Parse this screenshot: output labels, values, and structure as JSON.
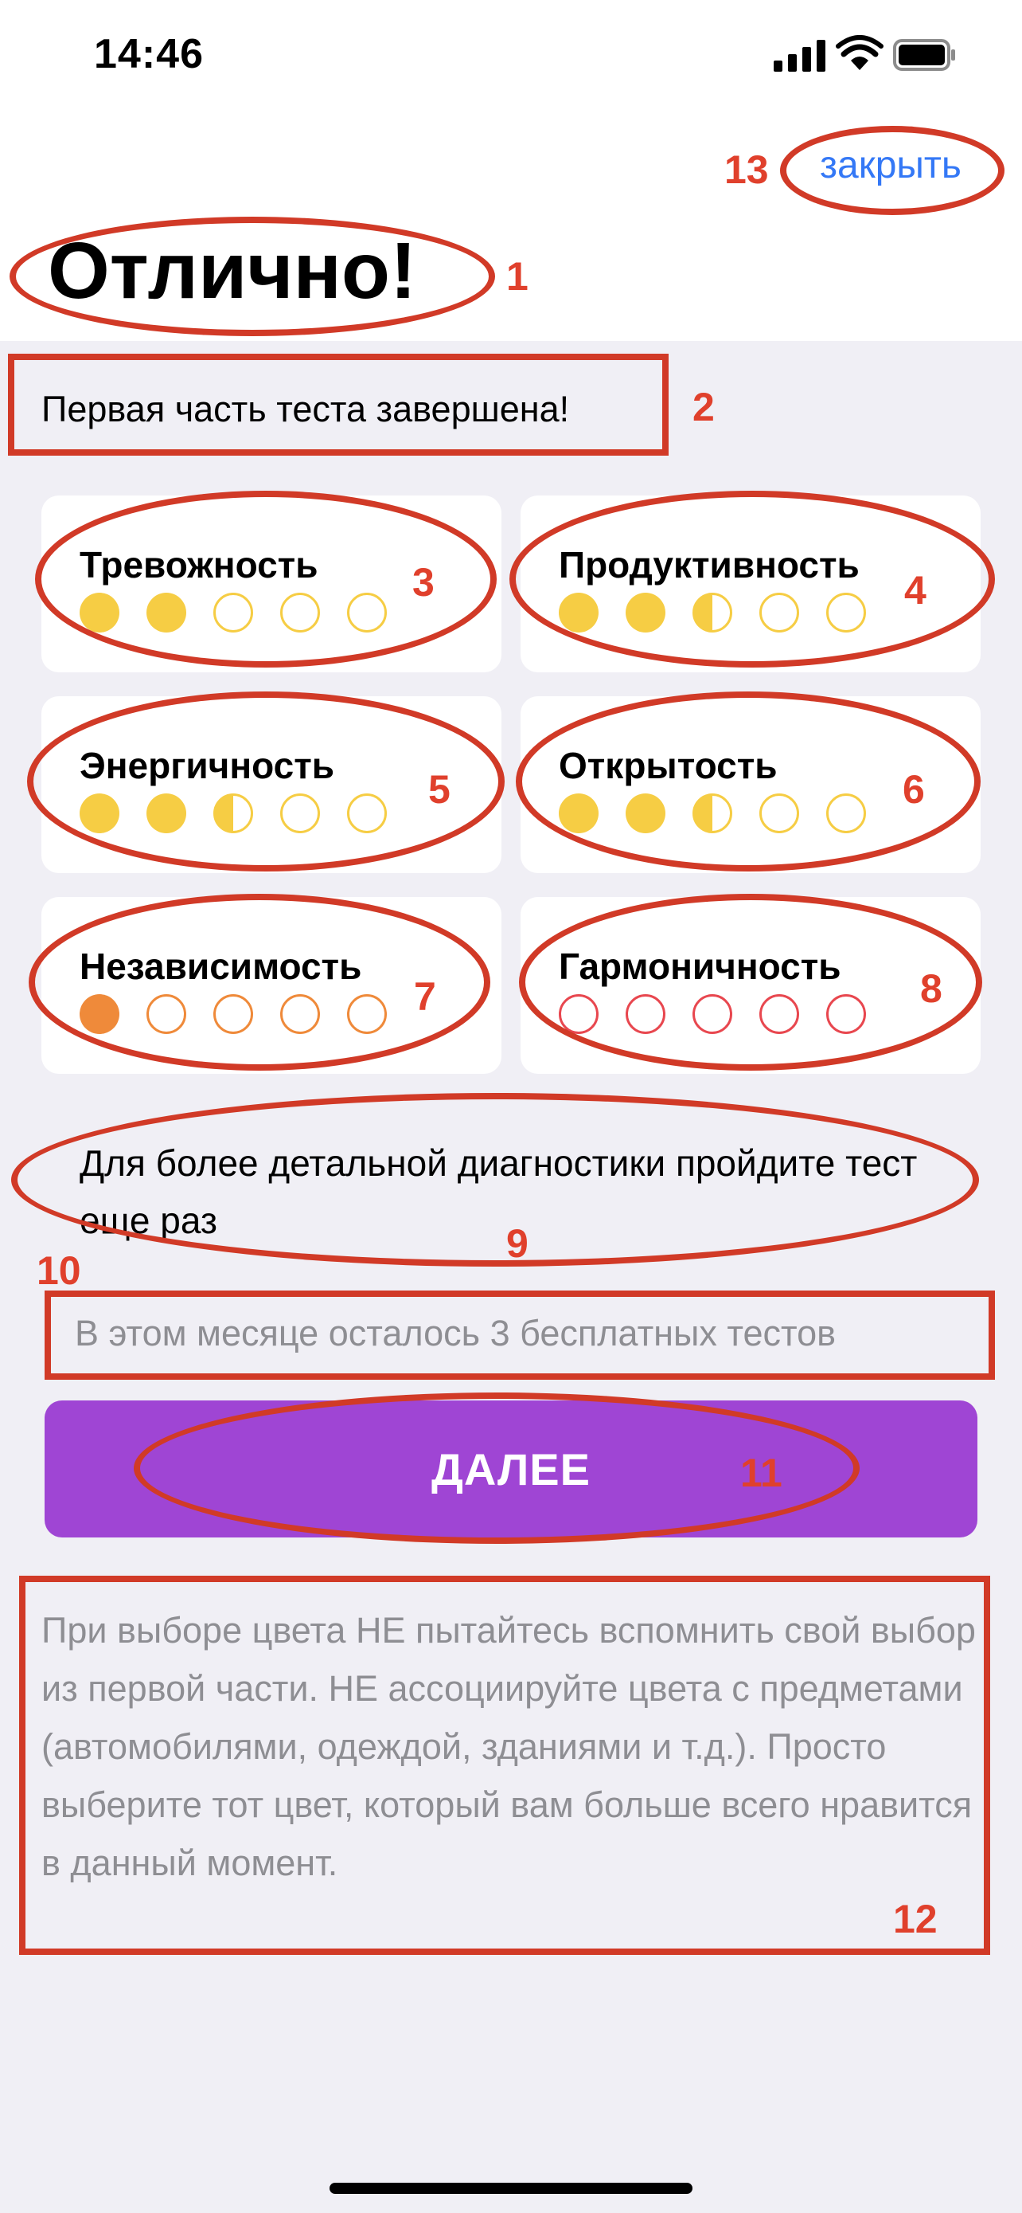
{
  "status_bar": {
    "time": "14:46"
  },
  "header": {
    "close_label": "закрыть",
    "title": "Отлично!"
  },
  "subtitle": "Первая часть теста завершена!",
  "traits": [
    {
      "label": "Тревожность",
      "color": "#f6cd44",
      "dots": [
        "full",
        "full",
        "empty",
        "empty",
        "empty"
      ]
    },
    {
      "label": "Продуктивность",
      "color": "#f6cd44",
      "dots": [
        "full",
        "full",
        "half",
        "empty",
        "empty"
      ]
    },
    {
      "label": "Энергичность",
      "color": "#f6cd44",
      "dots": [
        "full",
        "full",
        "half",
        "empty",
        "empty"
      ]
    },
    {
      "label": "Открытость",
      "color": "#f6cd44",
      "dots": [
        "full",
        "full",
        "half",
        "empty",
        "empty"
      ]
    },
    {
      "label": "Независимость",
      "color": "#ef8a3a",
      "dots": [
        "full",
        "empty",
        "empty",
        "empty",
        "empty"
      ]
    },
    {
      "label": "Гармоничность",
      "color": "#e8474f",
      "dots": [
        "empty",
        "empty",
        "empty",
        "empty",
        "empty"
      ]
    }
  ],
  "detail_text": "Для более детальной диагностики пройдите тест еще раз",
  "remaining_text": "В этом месяце осталось 3 бесплатных тестов",
  "next_button": {
    "label": "ДАЛЕЕ",
    "color": "#9f45d4"
  },
  "note_text": "При выборе цвета НЕ пытайтесь вспомнить свой выбор из первой части. НЕ ассоциируйте цвета с предметами (автомобилями, одеждой, зданиями и т.д.). Просто выберите тот цвет, который вам больше всего нравится в данный момент.",
  "annotations": [
    "1",
    "2",
    "3",
    "4",
    "5",
    "6",
    "7",
    "8",
    "9",
    "10",
    "11",
    "12",
    "13"
  ]
}
